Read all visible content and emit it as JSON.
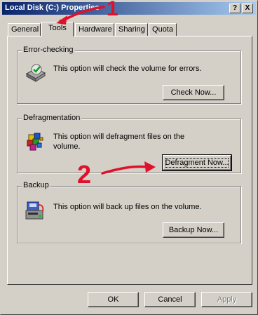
{
  "window": {
    "title": "Local Disk (C:) Properties",
    "help_button": "?",
    "close_button": "X"
  },
  "tabs": [
    {
      "label": "General",
      "active": false
    },
    {
      "label": "Tools",
      "active": true
    },
    {
      "label": "Hardware",
      "active": false
    },
    {
      "label": "Sharing",
      "active": false
    },
    {
      "label": "Quota",
      "active": false
    }
  ],
  "error_checking": {
    "label": "Error-checking",
    "text": "This option will check the volume for errors.",
    "button": "Check Now...",
    "icon": "disk-check-icon"
  },
  "defragmentation": {
    "label": "Defragmentation",
    "text": "This option will defragment files on the volume.",
    "button": "Defragment Now...",
    "icon": "defrag-icon"
  },
  "backup": {
    "label": "Backup",
    "text": "This option will back up files on the volume.",
    "button": "Backup Now...",
    "icon": "backup-icon"
  },
  "footer": {
    "ok": "OK",
    "cancel": "Cancel",
    "apply": "Apply"
  },
  "annotations": {
    "step1": "1",
    "step2": "2",
    "color": "#e0102a"
  }
}
